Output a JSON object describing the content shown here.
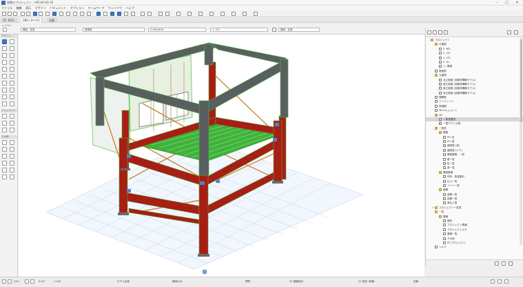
{
  "window": {
    "title": "無題のプロジェクト - ARCHICAD 26",
    "controls": {
      "minimize": "–",
      "maximize": "□",
      "close": "✕"
    }
  },
  "menubar": {
    "items": [
      "ファイル",
      "編集",
      "表示",
      "デザイン",
      "ドキュメント",
      "オプション",
      "チームワーク",
      "ウィンドウ",
      "ヘルプ"
    ]
  },
  "tabs": [
    {
      "label": "[1. 1FL]",
      "active": false
    },
    {
      "label": "[3D / すべて]",
      "active": true
    },
    {
      "label": "立面",
      "active": false
    }
  ],
  "infobar": {
    "layer_label": "レイヤー",
    "layer_value": "構造 - 柱梁",
    "fields": [
      "構造 - 柱梁",
      "鉄骨梁",
      "H-300x150",
      "1. 1FL"
    ]
  },
  "toolbox": {
    "sections": [
      "デザイン",
      "ドキュメント",
      "その他"
    ]
  },
  "navigator": {
    "rows": [
      {
        "label": "プロジェクト",
        "level": 0,
        "icon": "folder",
        "expand": "-"
      },
      {
        "label": "平面図",
        "level": 1,
        "icon": "folder",
        "expand": "-"
      },
      {
        "label": "3. RFL",
        "level": 2,
        "icon": "plan"
      },
      {
        "label": "2. 2FL",
        "level": 2,
        "icon": "plan"
      },
      {
        "label": "1. 1FL",
        "level": 2,
        "icon": "plan"
      },
      {
        "label": "0. GL",
        "level": 2,
        "icon": "plan"
      },
      {
        "label": "-1. 基礎",
        "level": 2,
        "icon": "plan"
      },
      {
        "label": "断面図",
        "level": 1,
        "icon": "plan"
      },
      {
        "label": "立面図",
        "level": 1,
        "icon": "folder",
        "expand": "-"
      },
      {
        "label": "北立面図 (自動再構築モデル)",
        "level": 2,
        "icon": "plan"
      },
      {
        "label": "南立面図 (自動再構築モデル)",
        "level": 2,
        "icon": "plan"
      },
      {
        "label": "東立面図 (自動再構築モデル)",
        "level": 2,
        "icon": "plan"
      },
      {
        "label": "西立面図 (自動再構築モデル)",
        "level": 2,
        "icon": "plan"
      },
      {
        "label": "展開図",
        "level": 1,
        "icon": "plan"
      },
      {
        "label": "ワークシート",
        "level": 1,
        "icon": "plan"
      },
      {
        "label": "詳細図",
        "level": 1,
        "icon": "plan"
      },
      {
        "label": "3Dドキュメント",
        "level": 1,
        "icon": "plan"
      },
      {
        "label": "3D",
        "level": 1,
        "icon": "folder",
        "expand": "-"
      },
      {
        "label": "一般透視図",
        "level": 2,
        "icon": "box",
        "selected": true
      },
      {
        "label": "一般アクソメ図",
        "level": 2,
        "icon": "box"
      },
      {
        "label": "一覧表",
        "level": 1,
        "icon": "folder",
        "expand": "-"
      },
      {
        "label": "要素",
        "level": 2,
        "icon": "folder",
        "expand": "-"
      },
      {
        "label": "IFC 柱",
        "level": 3,
        "icon": "plan"
      },
      {
        "label": "IFC 梁",
        "level": 3,
        "icon": "plan"
      },
      {
        "label": "建具表 (窓)",
        "level": 3,
        "icon": "plan"
      },
      {
        "label": "建具表 (ドア)",
        "level": 3,
        "icon": "plan"
      },
      {
        "label": "構造要素 - 一覧",
        "level": 3,
        "icon": "plan"
      },
      {
        "label": "壁一覧",
        "level": 3,
        "icon": "plan"
      },
      {
        "label": "柱一覧",
        "level": 3,
        "icon": "plan"
      },
      {
        "label": "梁一覧",
        "level": 3,
        "icon": "plan"
      },
      {
        "label": "構成要素",
        "level": 2,
        "icon": "folder",
        "expand": "-"
      },
      {
        "label": "材料 - 数量集計",
        "level": 3,
        "icon": "plan"
      },
      {
        "label": "仕上一覧",
        "level": 3,
        "icon": "plan"
      },
      {
        "label": "ゾーン一覧",
        "level": 3,
        "icon": "plan"
      },
      {
        "label": "面積",
        "level": 2,
        "icon": "folder",
        "expand": "-"
      },
      {
        "label": "面積一覧",
        "level": 3,
        "icon": "plan"
      },
      {
        "label": "部屋一覧",
        "level": 3,
        "icon": "plan"
      },
      {
        "label": "室仕上表",
        "level": 3,
        "icon": "plan"
      },
      {
        "label": "プロジェクト一覧表",
        "level": 1,
        "icon": "folder",
        "expand": "+"
      },
      {
        "label": "一覧",
        "level": 1,
        "icon": "folder",
        "expand": "-"
      },
      {
        "label": "情報",
        "level": 2,
        "icon": "folder",
        "expand": "-"
      },
      {
        "label": "報告",
        "level": 3,
        "icon": "plan"
      },
      {
        "label": "プロジェクト情報",
        "level": 3,
        "icon": "plan"
      },
      {
        "label": "プロジェクトメモ",
        "level": 3,
        "icon": "plan"
      },
      {
        "label": "要素一覧",
        "level": 3,
        "icon": "plan"
      },
      {
        "label": "その他",
        "level": 3,
        "icon": "plan"
      },
      {
        "label": "IFCプロジェクト",
        "level": 3,
        "icon": "plan"
      },
      {
        "label": "ヘルプ",
        "level": 1,
        "icon": "plan"
      }
    ]
  },
  "statusbar": {
    "zoom": "23%",
    "angle": "0.00°",
    "scale": "1:100",
    "items": [
      "モデル全体",
      "構造のみ",
      "標準",
      "02 建築設計",
      "01 既存+新築",
      "自動"
    ]
  },
  "colors": {
    "steel_red": "#a81e14",
    "steel_grey": "#5a5e60",
    "grating": "#3fb33a",
    "brace": "#c58a36",
    "grid_line": "#c7d6ee"
  }
}
